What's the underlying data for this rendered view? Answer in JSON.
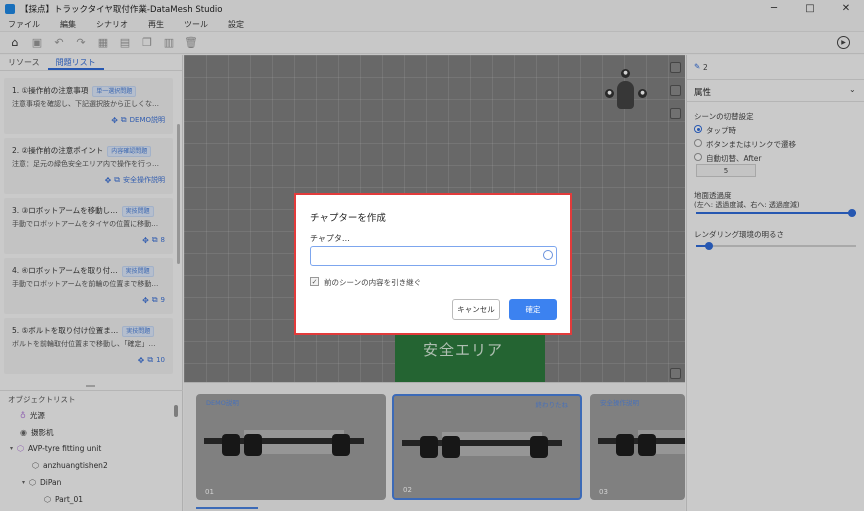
{
  "window": {
    "title": "【採点】トラックタイヤ取付作業-DataMesh Studio",
    "controls": [
      "─",
      "□",
      "✕"
    ]
  },
  "menu": [
    "ファイル",
    "編集",
    "シナリオ",
    "再生",
    "ツール",
    "設定"
  ],
  "left_panel": {
    "tabs": [
      "リソース",
      "問題リスト"
    ],
    "questions": [
      {
        "title": "1. ①操作前の注意事項",
        "badge": "単一選択問題",
        "desc": "注意事項を確認し、下記選択肢から正しくな…",
        "link": "DEMO説明"
      },
      {
        "title": "2. ②操作前の注意ポイント",
        "badge": "内容確認問題",
        "desc": "注意：足元の緑色安全エリア内で操作を行っ…",
        "link": "安全操作説明"
      },
      {
        "title": "3. ③ロボットアームを移動し…",
        "badge": "実技問題",
        "desc": "手動でロボットアームをタイヤの位置に移動…",
        "link": "8"
      },
      {
        "title": "4. ④ロボットアームを取り付…",
        "badge": "実技問題",
        "desc": "手動でロボットアームを前輪の位置まで移動…",
        "link": "9"
      },
      {
        "title": "5. ⑤ボルトを取り付け位置ま…",
        "badge": "実技問題",
        "desc": "ボルトを前輪取付位置まで移動し、「確定」…",
        "link": "10"
      }
    ],
    "object_list_title": "オブジェクトリスト",
    "objects": [
      {
        "label": "光源",
        "icon": "bulb-icon"
      },
      {
        "label": "摄影机",
        "icon": "camera-icon"
      },
      {
        "label": "AVP-tyre fitting unit",
        "icon": "model-icon"
      },
      {
        "label": "anzhuangtishen2",
        "icon": "cube-icon"
      },
      {
        "label": "DiPan",
        "icon": "cube-icon"
      },
      {
        "label": "Part_01",
        "icon": "cube-icon"
      }
    ]
  },
  "viewport": {
    "safe_area_text": "安全エリア"
  },
  "filmstrip": {
    "cards": [
      {
        "label": "DEMO説明",
        "label_right": "",
        "number": "01"
      },
      {
        "label": "",
        "label_right": "終わりたね",
        "number": "02"
      },
      {
        "label": "安全操作説明",
        "label_right": "",
        "number": "03"
      }
    ]
  },
  "right_panel": {
    "edit_count": "2",
    "section_title": "属性",
    "scene_switch_title": "シーンの切替設定",
    "radio_options": [
      "タップ時",
      "ボタンまたはリンクで遷移",
      "自動切替、After"
    ],
    "auto_seconds": "5",
    "ground_transparency_title": "地面透過度",
    "ground_transparency_hint": "(左へ: 透過度減、右へ: 透過度減)",
    "ground_transparency_value": 1.0,
    "render_brightness_title": "レンダリング環境の明るさ",
    "render_brightness_value": 0.08
  },
  "dialog": {
    "title": "チャプターを作成",
    "field_label": "チャプタ…",
    "input_value": "",
    "checkbox_label": "前のシーンの内容を引き継ぐ",
    "checkbox_checked": "✓",
    "cancel_label": "キャンセル",
    "ok_label": "確定"
  },
  "colors": {
    "accent": "#3c82f0",
    "dialog_border": "#e23b3b",
    "safe_area": "#2d7a3e"
  }
}
